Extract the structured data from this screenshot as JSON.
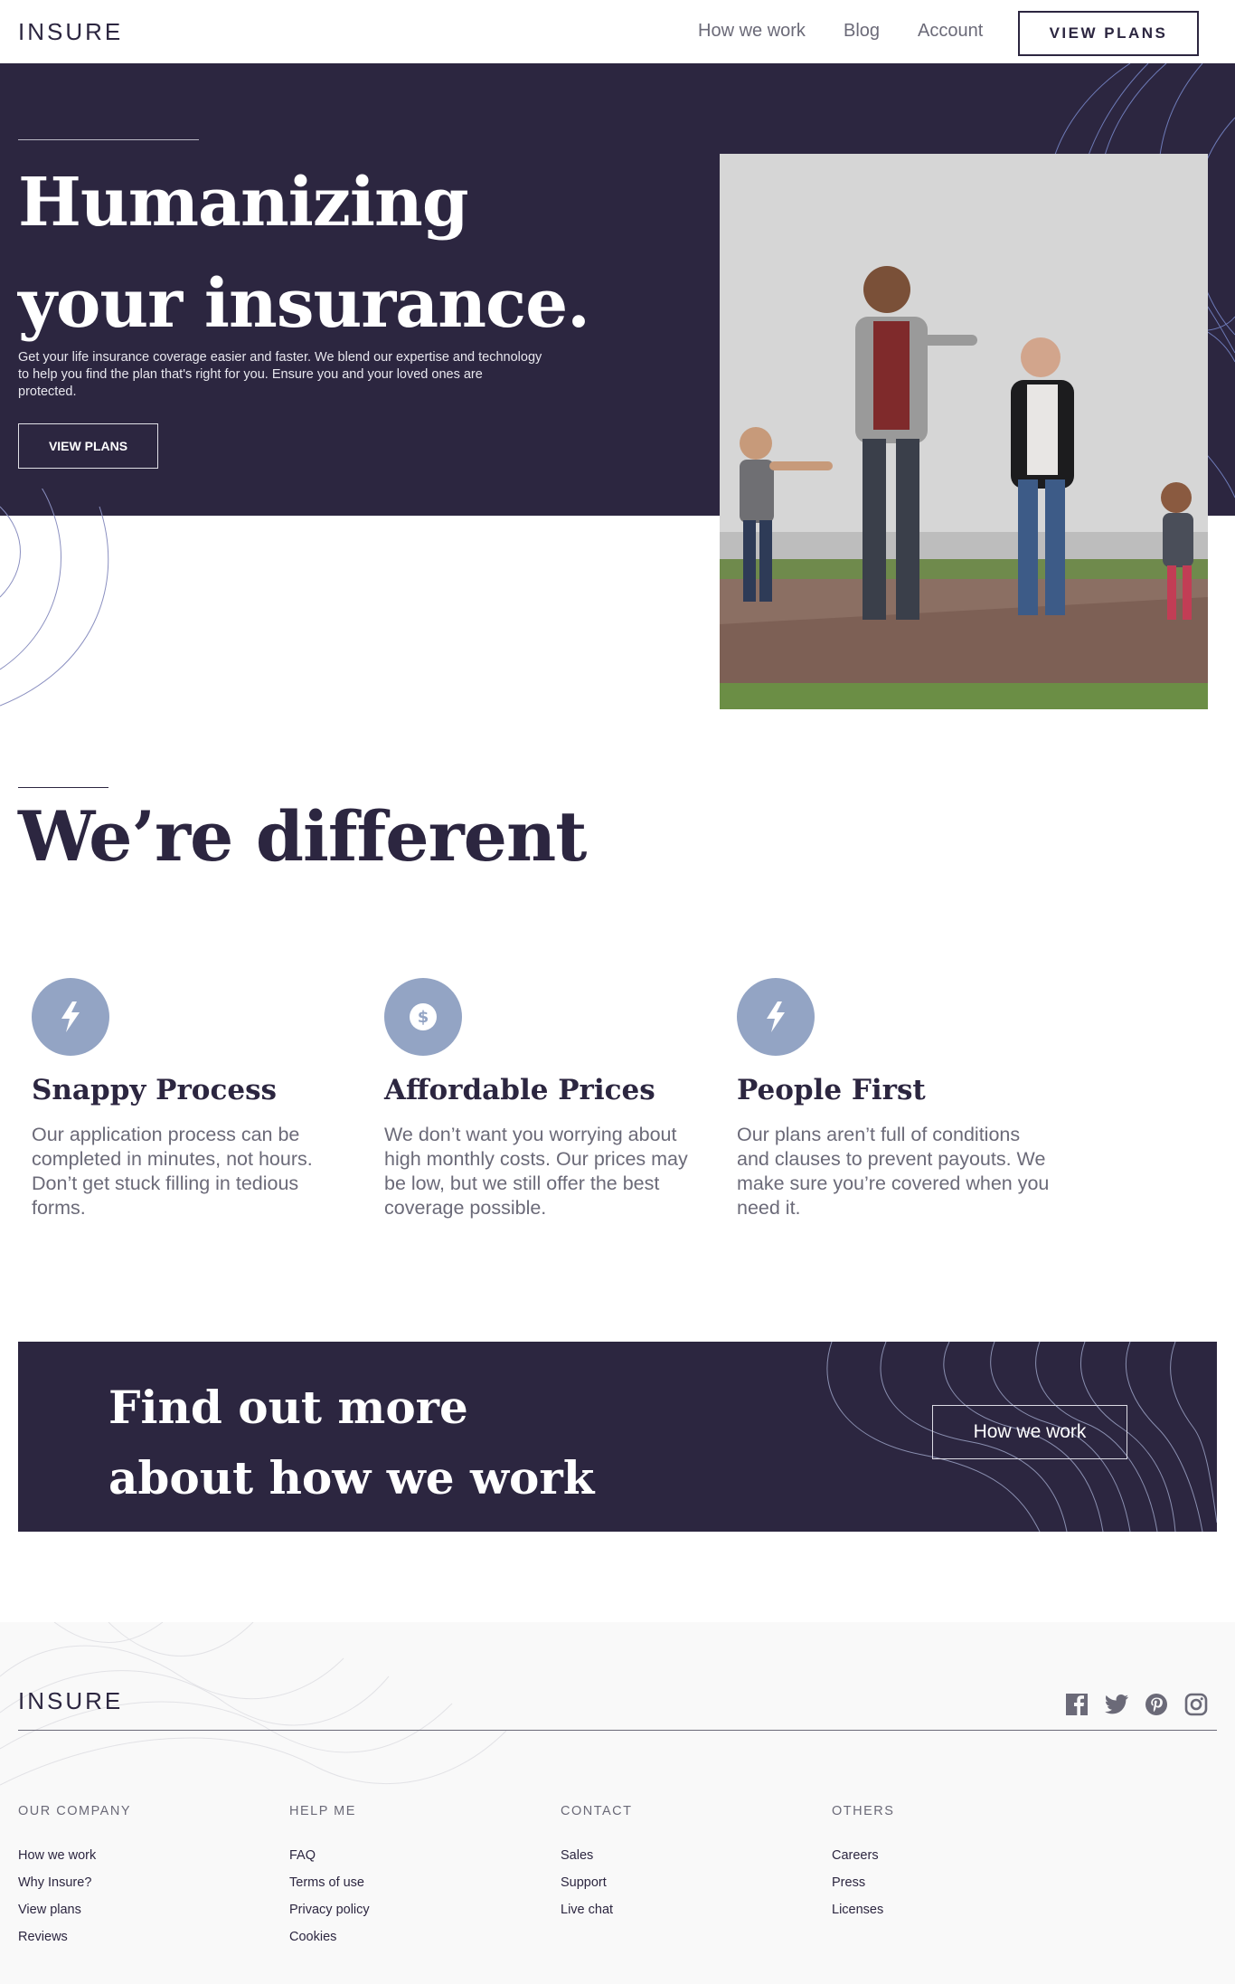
{
  "header": {
    "logo": "INSURE",
    "nav": [
      {
        "label": "How we work"
      },
      {
        "label": "Blog"
      },
      {
        "label": "Account"
      }
    ],
    "cta_label": "VIEW PLANS"
  },
  "hero": {
    "title_line1": "Humanizing",
    "title_line2": "your insurance.",
    "text": "Get your life insurance coverage easier and faster. We blend our expertise and technology to help you find the plan that's right for you. Ensure you and your loved ones are protected.",
    "button_label": "VIEW PLANS"
  },
  "different": {
    "title": "We’re different",
    "features": [
      {
        "icon": "lightning-bolt-icon",
        "title": "Snappy Process",
        "text": "Our application process can be completed in minutes, not hours. Don’t get stuck filling in tedious forms."
      },
      {
        "icon": "dollar-icon",
        "title": "Affordable Prices",
        "text": "We don’t want you worrying about high monthly costs. Our prices may be low, but we still offer the best coverage possible."
      },
      {
        "icon": "lightning-bolt-icon",
        "title": "People First",
        "text": "Our plans aren’t full of conditions and clauses to prevent payouts. We make sure you’re covered when you need it."
      }
    ]
  },
  "cta": {
    "title_line1": "Find out more",
    "title_line2": "about how we work",
    "button_label": "How we work"
  },
  "footer": {
    "logo": "INSURE",
    "social": [
      "facebook-icon",
      "twitter-icon",
      "pinterest-icon",
      "instagram-icon"
    ],
    "columns": [
      {
        "heading": "OUR COMPANY",
        "links": [
          "How we work",
          "Why Insure?",
          "View plans",
          "Reviews"
        ]
      },
      {
        "heading": "HELP ME",
        "links": [
          "FAQ",
          "Terms of use",
          "Privacy policy",
          "Cookies"
        ]
      },
      {
        "heading": "CONTACT",
        "links": [
          "Sales",
          "Support",
          "Live chat"
        ]
      },
      {
        "heading": "OTHERS",
        "links": [
          "Careers",
          "Press",
          "Licenses"
        ]
      }
    ]
  },
  "colors": {
    "dark_violet": "#2c2640",
    "grayish_violet": "#6b6a78",
    "icon_blue": "#93a4c4",
    "footer_bg": "#f9f9f9"
  }
}
